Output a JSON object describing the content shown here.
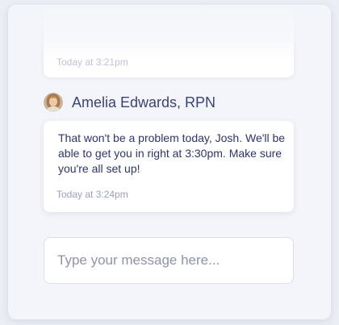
{
  "previous_message": {
    "timestamp": "Today at 3:21pm"
  },
  "message": {
    "sender_name": "Amelia Edwards, RPN",
    "text": "That won't be a problem today, Josh. We'll be able to get you in right at 3:30pm. Make sure you're all set up!",
    "timestamp": "Today at 3:24pm"
  },
  "composer": {
    "placeholder": "Type your message here..."
  },
  "colors": {
    "name_text": "#3a4377",
    "message_text": "#2d3470",
    "timestamp_text": "#9a9fbb",
    "bubble_bg": "#ffffff",
    "panel_bg": "#f4f5fa"
  }
}
